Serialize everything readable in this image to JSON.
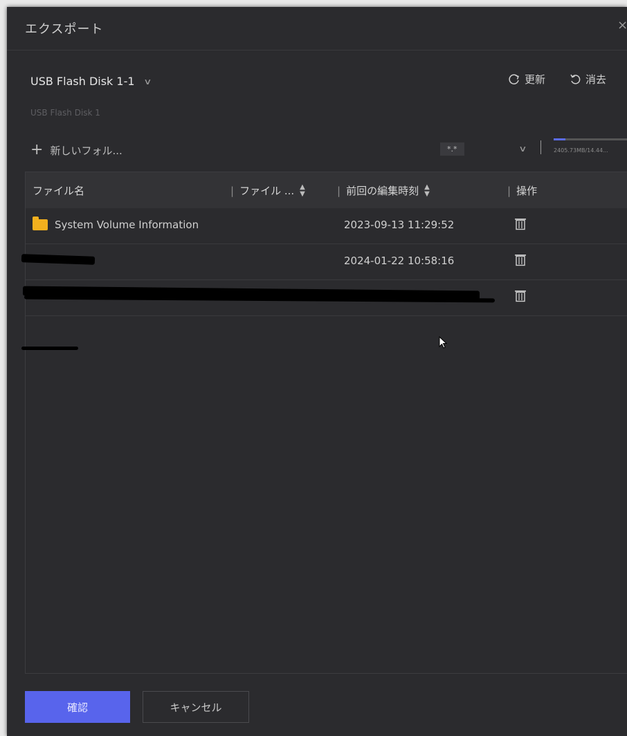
{
  "dialog": {
    "title": "エクスポート",
    "close_glyph": "×"
  },
  "device": {
    "selected": "USB Flash Disk 1-1",
    "subtitle": "USB Flash Disk 1"
  },
  "toolbar": {
    "refresh_label": "更新",
    "clear_label": "消去",
    "new_folder_label": "新しいフォル...",
    "filter_value": "*.*",
    "capacity_text": "2405.73MB/14.44...",
    "capacity_fraction": 0.16
  },
  "table": {
    "columns": [
      "ファイル名",
      "ファイル ...",
      "前回の編集時刻",
      "操作"
    ],
    "rows": [
      {
        "name": "System Volume Information",
        "modified": "2023-09-13 11:29:52",
        "is_folder": true
      },
      {
        "name": "",
        "modified": "2024-01-22 10:58:16",
        "is_folder": false
      },
      {
        "name": "",
        "modified": "",
        "is_folder": false
      }
    ]
  },
  "footer": {
    "confirm_label": "確認",
    "cancel_label": "キャンセル"
  },
  "colors": {
    "accent": "#5864ec",
    "folder": "#f2b01e",
    "background": "#2b2b2e"
  }
}
